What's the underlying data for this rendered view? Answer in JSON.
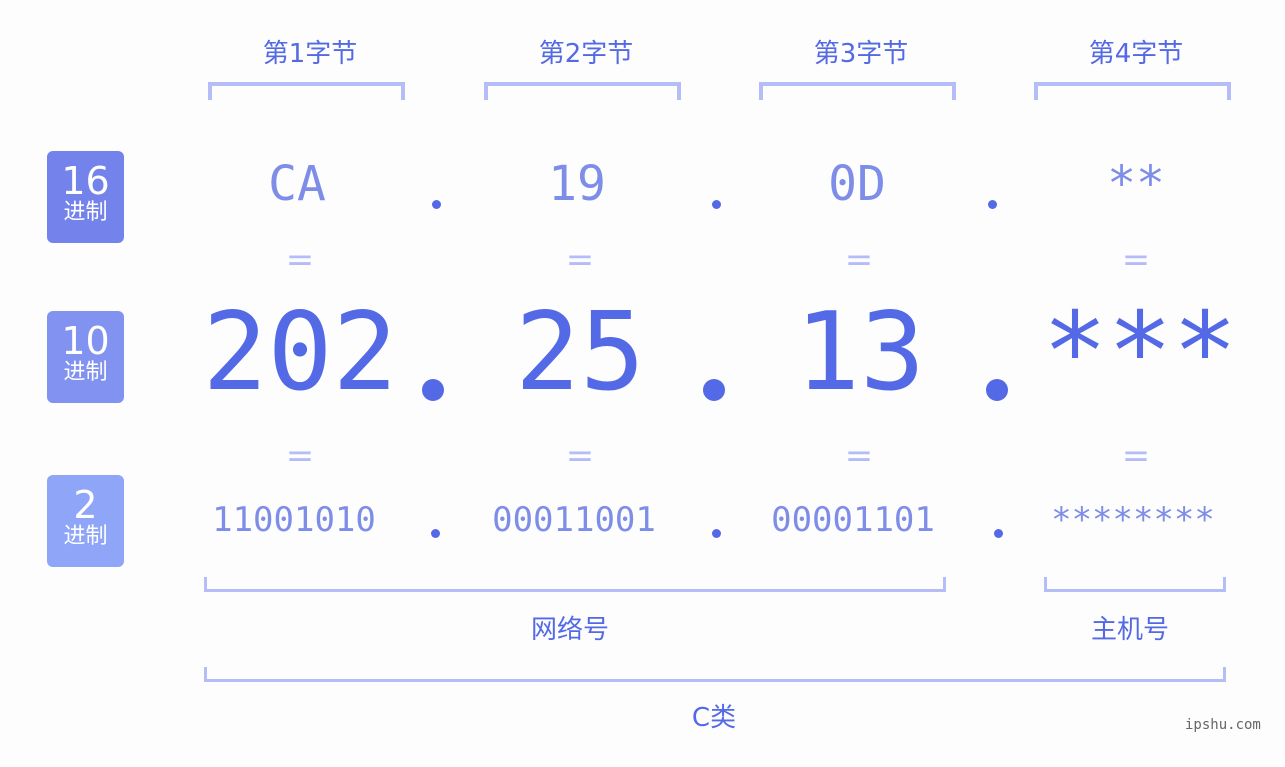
{
  "bytes": [
    {
      "label": "第1字节",
      "hex": "CA",
      "dec": "202",
      "bin": "11001010"
    },
    {
      "label": "第2字节",
      "hex": "19",
      "dec": "25",
      "bin": "00011001"
    },
    {
      "label": "第3字节",
      "hex": "0D",
      "dec": "13",
      "bin": "00001101"
    },
    {
      "label": "第4字节",
      "hex": "**",
      "dec": "***",
      "bin": "********"
    }
  ],
  "rows": [
    {
      "num": "16",
      "sub": "进制",
      "color": "#7483eb"
    },
    {
      "num": "10",
      "sub": "进制",
      "color": "#8192f0"
    },
    {
      "num": "2",
      "sub": "进制",
      "color": "#8ea5f8"
    }
  ],
  "equals_sign": "=",
  "groups": {
    "network": "网络号",
    "host": "主机号",
    "class": "C类"
  },
  "watermark": "ipshu.com",
  "colors": {
    "accent": "#5469e6",
    "light": "#7d8de8",
    "bracket": "#b4bdf8"
  }
}
